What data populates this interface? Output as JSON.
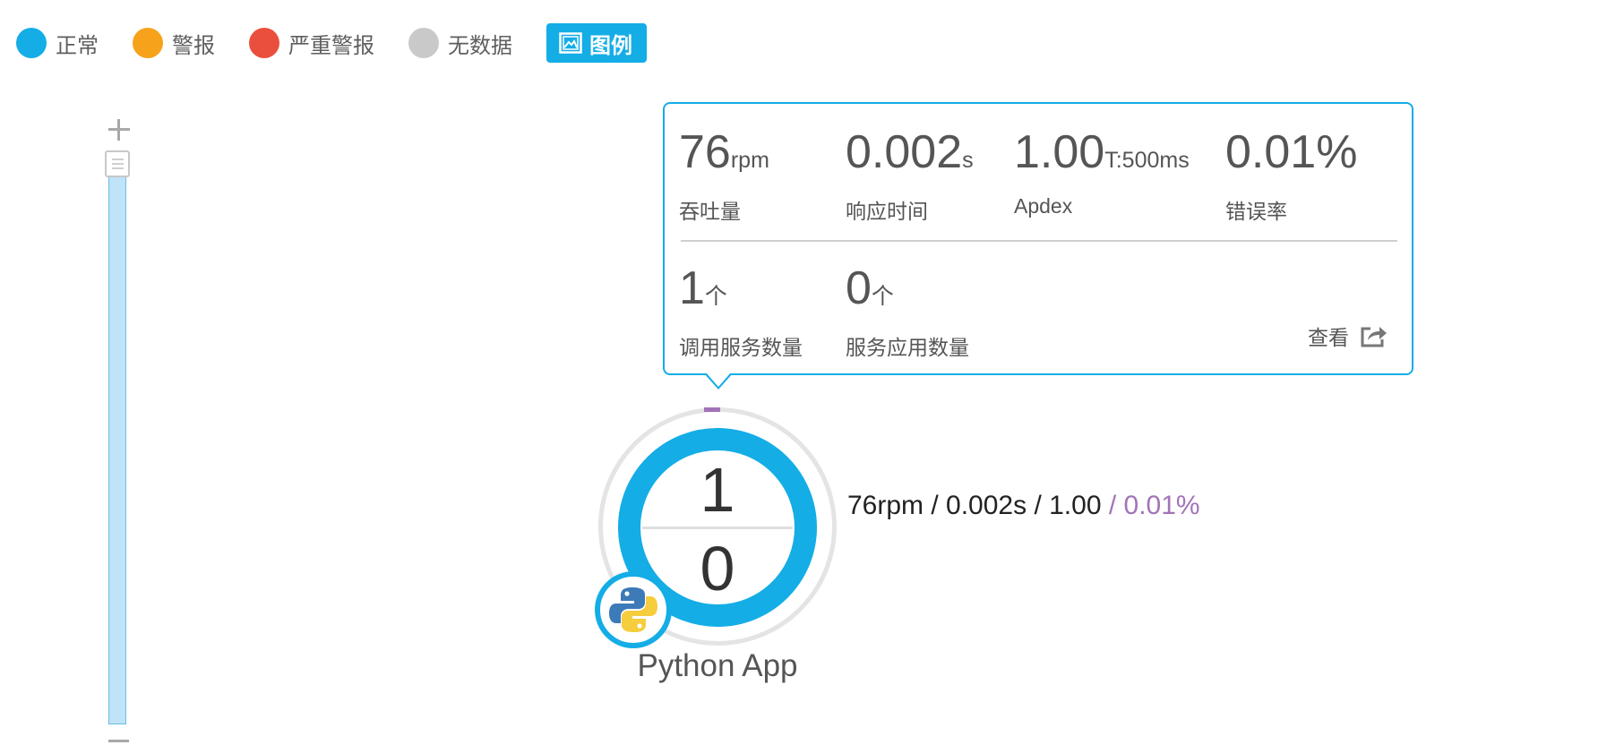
{
  "legend": {
    "items": [
      {
        "label": "正常",
        "color": "#14ade6"
      },
      {
        "label": "警报",
        "color": "#f7a21b"
      },
      {
        "label": "严重警报",
        "color": "#ea4f3d"
      },
      {
        "label": "无数据",
        "color": "#c9c9c9"
      }
    ],
    "toggle_label": "图例",
    "toggle_icon": "image-icon"
  },
  "tooltip": {
    "throughput": {
      "value": "76",
      "unit": "rpm",
      "label": "吞吐量"
    },
    "response_time": {
      "value": "0.002",
      "unit": "s",
      "label": "响应时间"
    },
    "apdex": {
      "value": "1.00",
      "unit": "T:500ms",
      "label": "Apdex"
    },
    "error_rate": {
      "value": "0.01%",
      "unit": "",
      "label": "错误率"
    },
    "called_services": {
      "value": "1",
      "unit": "个",
      "label": "调用服务数量"
    },
    "service_apps": {
      "value": "0",
      "unit": "个",
      "label": "服务应用数量"
    },
    "view_label": "查看",
    "view_icon": "external-link-icon"
  },
  "node": {
    "top_count": "1",
    "bottom_count": "0",
    "name": "Python App",
    "logo": "python-logo",
    "stats_main": "76rpm / 0.002s / 1.00",
    "stats_error": " / 0.01%",
    "status_color": "#14ade6",
    "error_color": "#a373b8"
  }
}
